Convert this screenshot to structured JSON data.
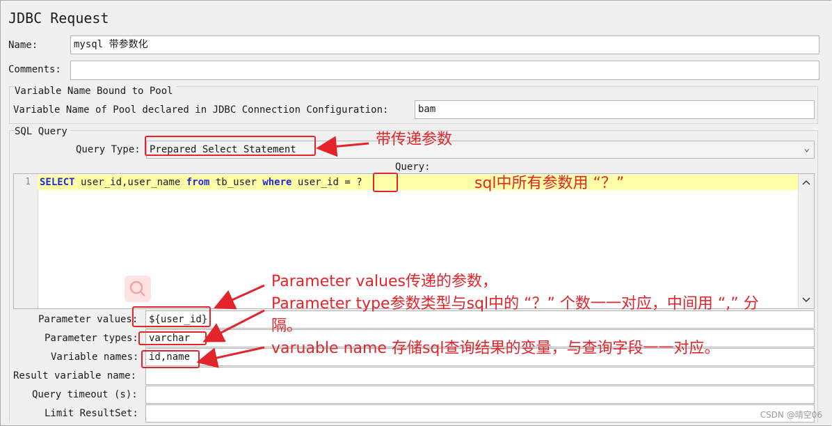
{
  "panel": {
    "title": "JDBC Request"
  },
  "name": {
    "label": "Name:",
    "value": "mysql 带参数化"
  },
  "comments": {
    "label": "Comments:",
    "value": ""
  },
  "pool": {
    "group_title": "Variable Name Bound to Pool",
    "label": "Variable Name of Pool declared in JDBC Connection Configuration:",
    "value": "bam"
  },
  "sql": {
    "group_title": "SQL Query",
    "query_type_label": "Query Type:",
    "query_type_value": "Prepared Select Statement",
    "query_label": "Query:",
    "line_number": "1",
    "code": {
      "kw_select": "SELECT",
      "t1": " user_id,user_name ",
      "kw_from": "from",
      "t2": " tb_user ",
      "kw_where": "where",
      "t3": " user_id = ",
      "param": "?"
    }
  },
  "params": {
    "values_label": "Parameter values:",
    "values_value": "${user_id}",
    "types_label": "Parameter types:",
    "types_value": "varchar",
    "names_label": "Variable names:",
    "names_value": "id,name",
    "result_label": "Result variable name:",
    "result_value": "",
    "timeout_label": "Query timeout (s):",
    "timeout_value": "",
    "limit_label": "Limit ResultSet:",
    "limit_value": ""
  },
  "annotations": {
    "query_type_note": "带传递参数",
    "sql_note": "sql中所有参数用 “？”",
    "param_values_note": "Parameter values传递的参数，",
    "param_types_note_1": "Parameter type参数类型与sql中的 “？” 个数一一对应，中间用 “,” 分",
    "param_types_note_2": "隔。",
    "var_names_note": "varuable name 存储sql查询结果的变量，与查询字段一一对应。"
  },
  "watermark": "CSDN @晴空06",
  "icons": [
    "chevron-down-icon",
    "scroll-up-icon",
    "scroll-down-icon",
    "search-icon",
    "arrow-icon"
  ],
  "colors": {
    "annotation": "#e3242b",
    "keyword": "#1d2bd8",
    "highlight_line": "#ffffa8"
  }
}
